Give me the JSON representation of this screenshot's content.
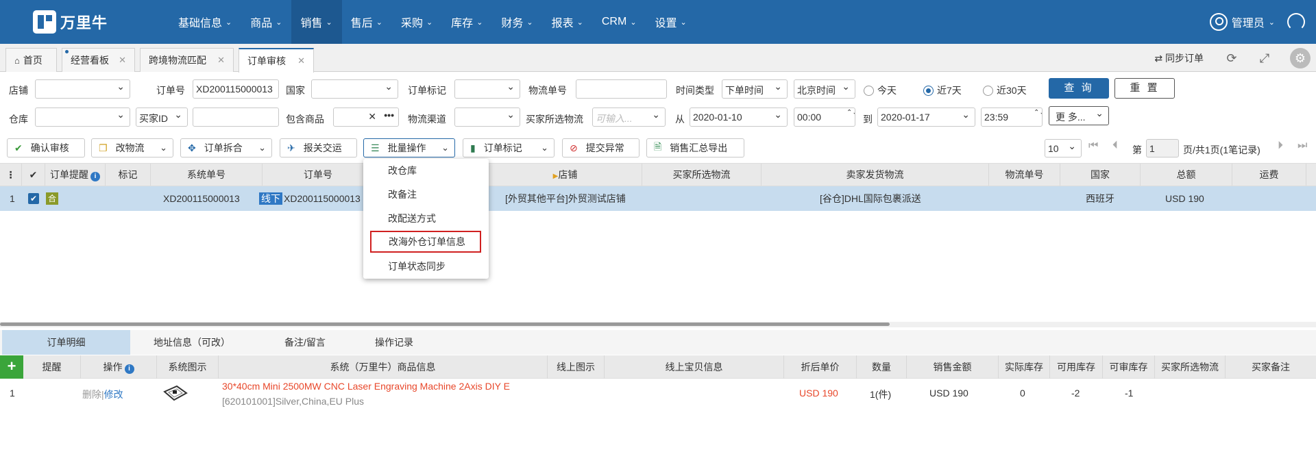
{
  "app": {
    "logo_text": "万里牛"
  },
  "nav": [
    {
      "label": "基础信息"
    },
    {
      "label": "商品"
    },
    {
      "label": "销售"
    },
    {
      "label": "售后"
    },
    {
      "label": "采购"
    },
    {
      "label": "库存"
    },
    {
      "label": "财务"
    },
    {
      "label": "报表"
    },
    {
      "label": "CRM"
    },
    {
      "label": "设置"
    }
  ],
  "user": {
    "name": "管理员"
  },
  "tabs": [
    {
      "label": "首页"
    },
    {
      "label": "经营看板"
    },
    {
      "label": "跨境物流匹配"
    },
    {
      "label": "订单审核"
    }
  ],
  "tabbar_right": {
    "sync": "同步订单"
  },
  "filters": {
    "shop": "店铺",
    "order_no": "订单号",
    "order_no_value": "XD200115000013",
    "country": "国家",
    "order_mark": "订单标记",
    "logistics_no": "物流单号",
    "time_type": "时间类型",
    "time_type_value": "下单时间",
    "timezone": "北京时间",
    "today": "今天",
    "last7": "近7天",
    "last30": "近30天",
    "query": "查 询",
    "reset": "重 置",
    "warehouse": "仓库",
    "buyer_id": "买家ID",
    "contains_goods": "包含商品",
    "logistics_channel": "物流渠道",
    "buyer_logistics": "买家所选物流",
    "buyer_logistics_placeholder": "可输入...",
    "from": "从",
    "date_from": "2020-01-10",
    "time_from": "00:00",
    "to": "到",
    "date_to": "2020-01-17",
    "time_to": "23:59",
    "more": "更 多..."
  },
  "toolbar": {
    "confirm": "确认审核",
    "change_logistics": "改物流",
    "split_merge": "订单拆合",
    "customs": "报关交运",
    "batch": "批量操作",
    "mark": "订单标记",
    "submit_exception": "提交异常",
    "export": "销售汇总导出"
  },
  "pager": {
    "page_size": "10",
    "page_label": "第",
    "page_value": "1",
    "page_info": "页/共1页(1笔记录)"
  },
  "grid": {
    "headers": [
      "订单提醒",
      "标记",
      "系统单号",
      "订单号",
      "店铺",
      "买家所选物流",
      "卖家发货物流",
      "物流单号",
      "国家",
      "总额",
      "运费"
    ],
    "row": {
      "index": "1",
      "he": "合",
      "sys_no": "XD200115000013",
      "line_badge": "线下",
      "order_no": "XD200115000013",
      "shop": "[外贸其他平台]外贸测试店铺",
      "seller_logistics": "[谷仓]DHL国际包裹派送",
      "country": "西班牙",
      "total": "USD 190"
    }
  },
  "batch_menu": [
    "改仓库",
    "改备注",
    "改配送方式",
    "改海外仓订单信息",
    "订单状态同步"
  ],
  "bottom_tabs": [
    "订单明细",
    "地址信息（可改）",
    "备注/留言",
    "操作记录"
  ],
  "detail": {
    "headers": [
      "提醒",
      "操作",
      "系统图示",
      "系统（万里牛）商品信息",
      "线上图示",
      "线上宝贝信息",
      "折后单价",
      "数量",
      "销售金额",
      "实际库存",
      "可用库存",
      "可审库存",
      "买家所选物流",
      "买家备注"
    ],
    "row": {
      "index": "1",
      "delete": "删除",
      "sep": "|",
      "edit": "修改",
      "title": "30*40cm Mini 2500MW CNC Laser Engraving Machine 2Axis DIY E",
      "sku": "[620101001]Silver,China,EU Plus",
      "price": "USD 190",
      "qty": "1(件)",
      "amount": "USD 190",
      "actual": "0",
      "available": "-2",
      "auditable": "-1"
    }
  }
}
